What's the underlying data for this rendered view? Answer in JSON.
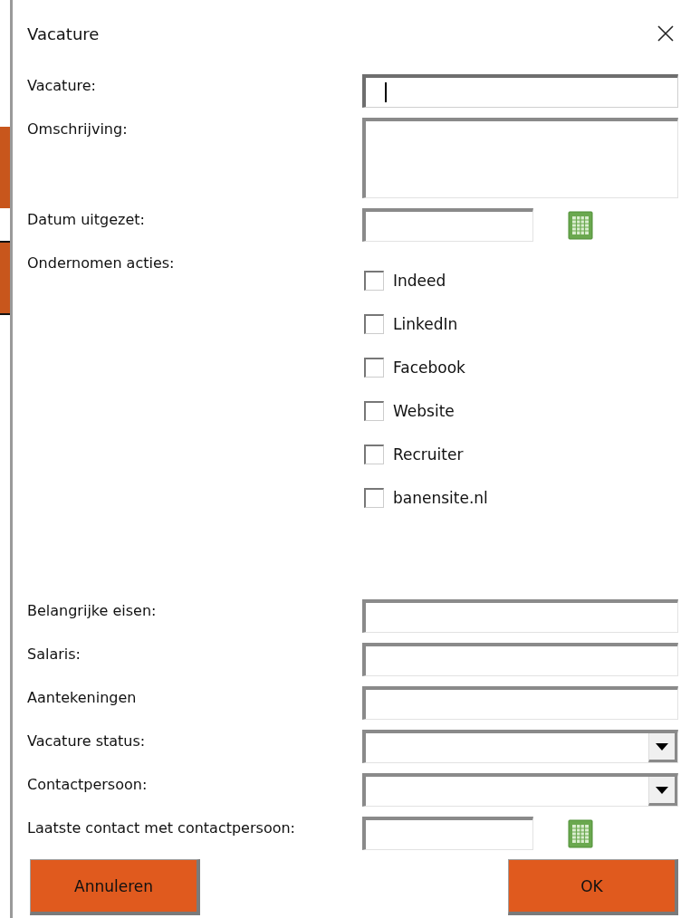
{
  "window": {
    "title": "Vacature"
  },
  "fields": [
    {
      "label": "Vacature:",
      "kind": "text",
      "focused": true
    },
    {
      "label": "Omschrijving:",
      "kind": "textarea",
      "focused": false
    },
    {
      "label": "Datum uitgezet:",
      "kind": "date",
      "focused": false
    },
    {
      "label": "Ondernomen acties:",
      "kind": "checkboxes",
      "options": [
        {
          "label": "Indeed",
          "checked": false
        },
        {
          "label": "LinkedIn",
          "checked": false
        },
        {
          "label": "Facebook",
          "checked": false
        },
        {
          "label": "Website",
          "checked": false
        },
        {
          "label": "Recruiter",
          "checked": false
        },
        {
          "label": "banensite.nl",
          "checked": false
        }
      ]
    },
    {
      "label": "Belangrijke eisen:",
      "kind": "text",
      "focused": false
    },
    {
      "label": "Salaris:",
      "kind": "text",
      "focused": false
    },
    {
      "label": "Aantekeningen",
      "kind": "text",
      "focused": false
    },
    {
      "label": "Vacature status:",
      "kind": "select",
      "focused": false
    },
    {
      "label": "Contactpersoon:",
      "kind": "select",
      "focused": false
    },
    {
      "label": "Laatste contact met contactpersoon:",
      "kind": "date",
      "focused": false
    }
  ],
  "buttons": [
    {
      "label": "Annuleren"
    },
    {
      "label": "OK"
    }
  ]
}
